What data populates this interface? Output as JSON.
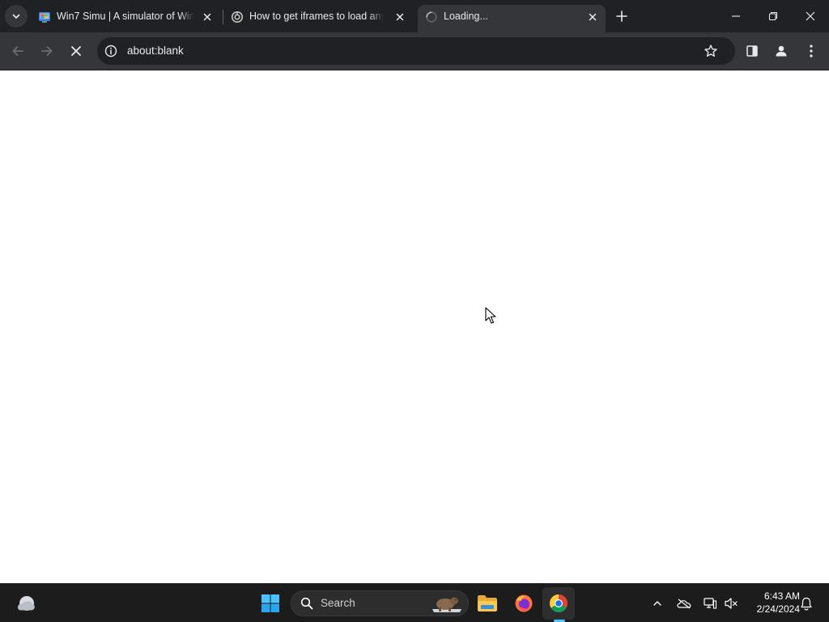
{
  "browser": {
    "tabs": [
      {
        "title": "Win7 Simu | A simulator of Win",
        "favicon": "win7simu-icon",
        "active": false
      },
      {
        "title": "How to get iframes to load any",
        "favicon": "web-icon",
        "active": false
      },
      {
        "title": "Loading...",
        "favicon": "loading-spinner-icon",
        "active": true
      }
    ],
    "address_bar": {
      "url": "about:blank"
    },
    "colors": {
      "tabstrip": "#202124",
      "toolbar": "#35363a",
      "text": "#e8eaed",
      "icon": "#c4c7c5"
    }
  },
  "taskbar": {
    "search_label": "Search",
    "clock": {
      "time": "6:43 AM",
      "date": "2/24/2024"
    },
    "colors": {
      "background": "#1c1c1c",
      "accent": "#4cc2ff"
    }
  }
}
